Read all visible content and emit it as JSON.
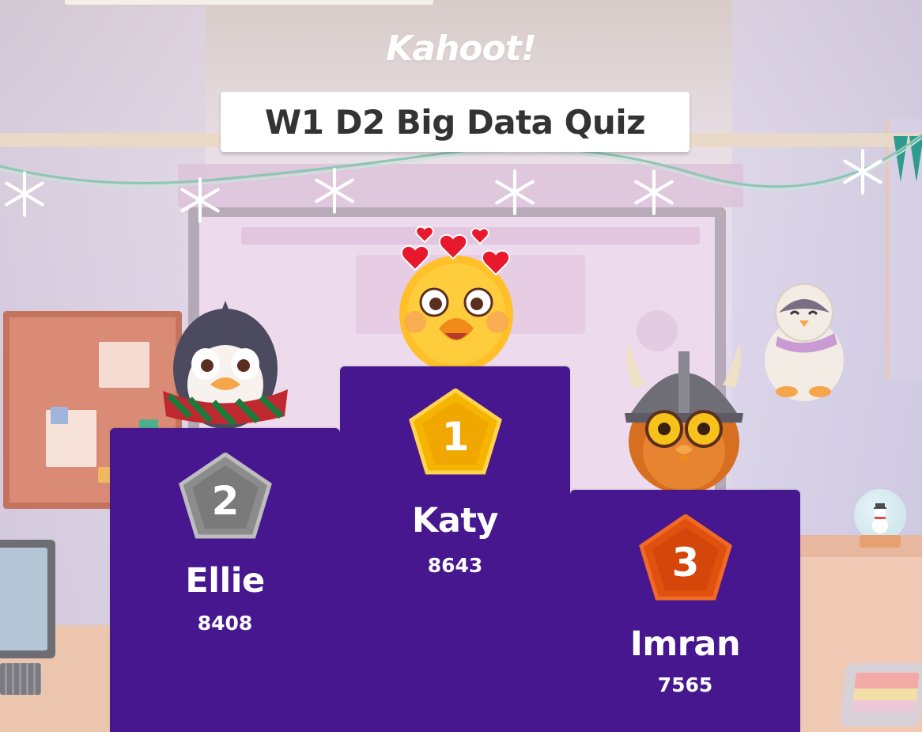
{
  "app": {
    "logo_text": "Kahoot!"
  },
  "quiz": {
    "title": "W1 D2 Big Data Quiz"
  },
  "podium": {
    "first": {
      "rank": "1",
      "name": "Katy",
      "score": "8643",
      "medal_color": "#f5b400",
      "avatar": "chick-with-hearts-icon"
    },
    "second": {
      "rank": "2",
      "name": "Ellie",
      "score": "8408",
      "medal_color": "#8c8c8c",
      "avatar": "penguin-with-scarf-icon"
    },
    "third": {
      "rank": "3",
      "name": "Imran",
      "score": "7565",
      "medal_color": "#e0500f",
      "avatar": "owl-viking-helmet-icon"
    }
  },
  "colors": {
    "podium": "#46178f",
    "title_text": "#333333",
    "title_box": "#ffffff"
  }
}
